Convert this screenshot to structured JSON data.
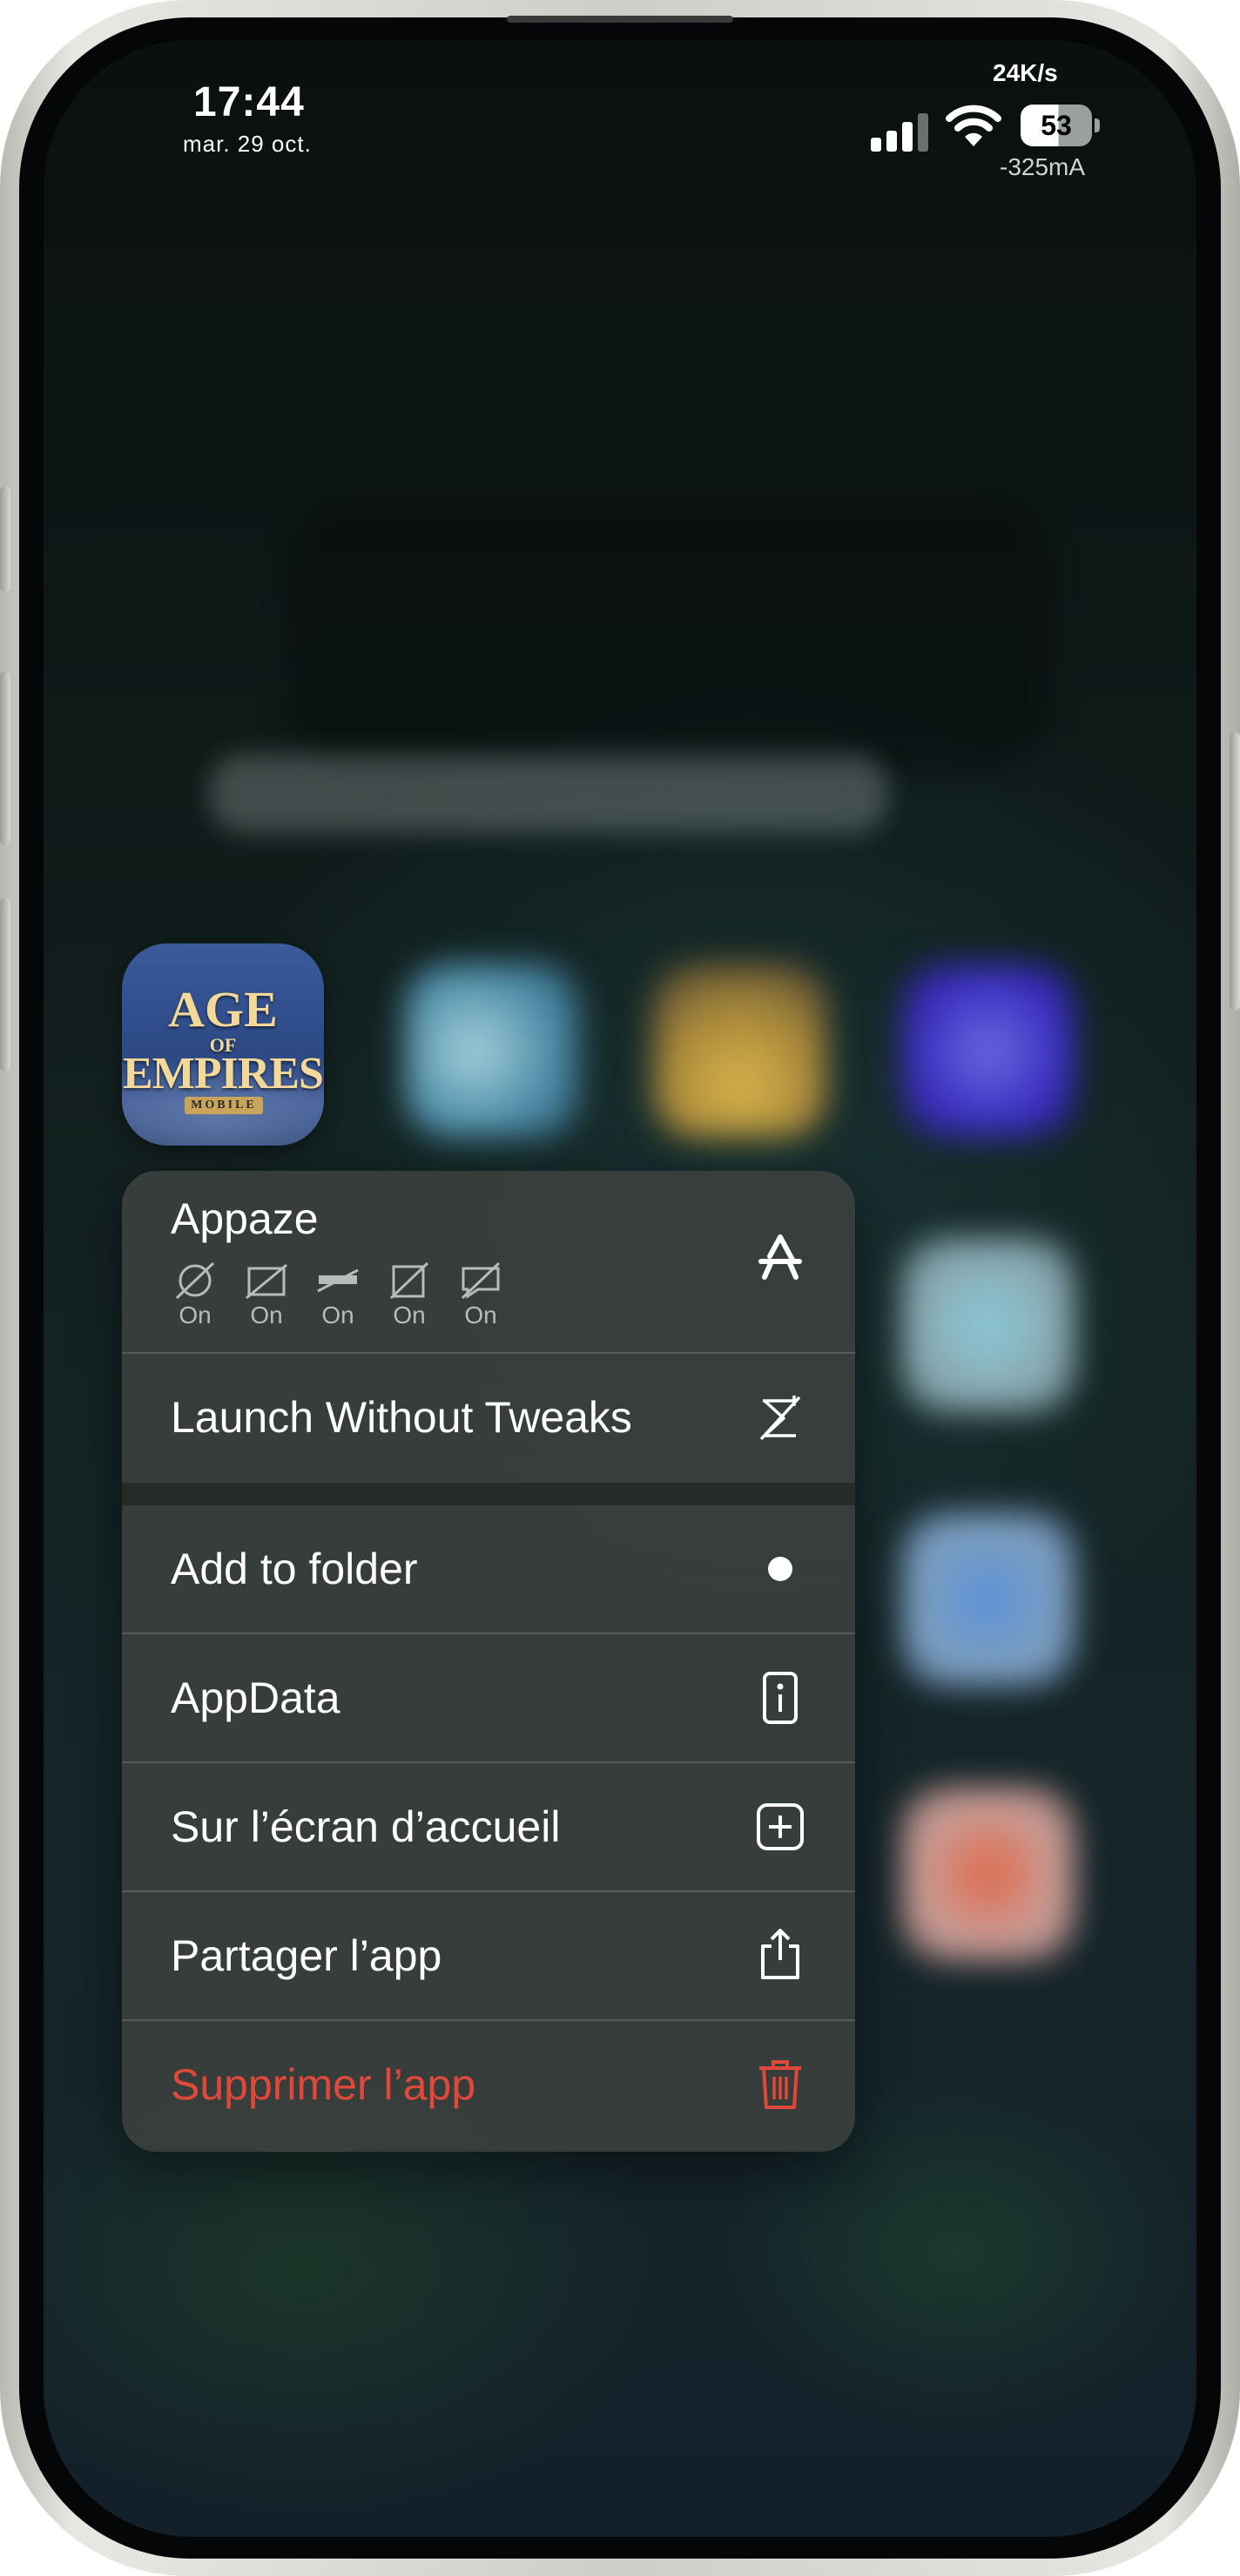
{
  "status_bar": {
    "time": "17:44",
    "date": "mar. 29 oct.",
    "network_speed": "24K/s",
    "battery_level": "53",
    "battery_current": "-325mA"
  },
  "app": {
    "icon_name": "age-of-empires-mobile-icon",
    "icon_text": {
      "line1": "AGE",
      "line2": "OF",
      "line3": "EMPIRES",
      "line4": "MOBILE"
    }
  },
  "context_menu": {
    "header": {
      "title": "Appaze",
      "tweak_states": [
        "On",
        "On",
        "On",
        "On",
        "On"
      ],
      "icon": "app-store-icon"
    },
    "launch_without_tweaks": {
      "label": "Launch Without Tweaks",
      "icon": "tweaks-off-icon"
    },
    "items": [
      {
        "label": "Add to folder",
        "icon": "dot-icon"
      },
      {
        "label": "AppData",
        "icon": "info-icon"
      },
      {
        "label": "Sur l’écran d’accueil",
        "icon": "plus-square-icon"
      },
      {
        "label": "Partager l’app",
        "icon": "share-icon"
      },
      {
        "label": "Supprimer l’app",
        "icon": "trash-icon"
      }
    ]
  },
  "colors": {
    "destructive": "#e0493a",
    "menu_background": "#3a3f3c"
  }
}
